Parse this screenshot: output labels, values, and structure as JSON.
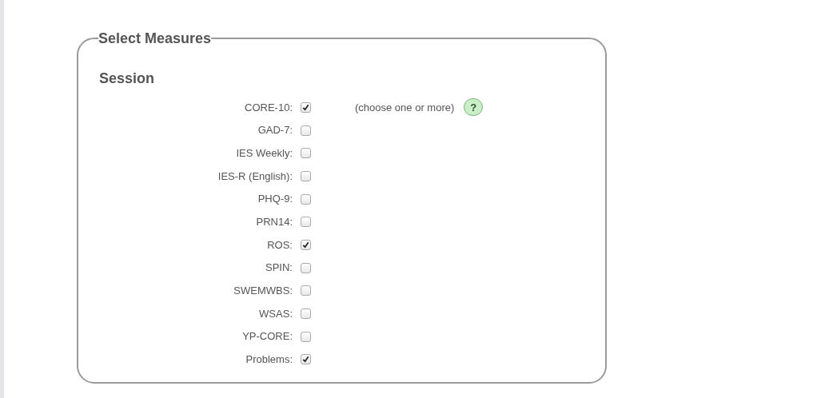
{
  "legend": "Select Measures",
  "section": "Session",
  "hint": "(choose one or more)",
  "help": "?",
  "measures": [
    {
      "label": "CORE-10:",
      "checked": true
    },
    {
      "label": "GAD-7:",
      "checked": false
    },
    {
      "label": "IES Weekly:",
      "checked": false
    },
    {
      "label": "IES-R (English):",
      "checked": false
    },
    {
      "label": "PHQ-9:",
      "checked": false
    },
    {
      "label": "PRN14:",
      "checked": false
    },
    {
      "label": "ROS:",
      "checked": true
    },
    {
      "label": "SPIN:",
      "checked": false
    },
    {
      "label": "SWEMWBS:",
      "checked": false
    },
    {
      "label": "WSAS:",
      "checked": false
    },
    {
      "label": "YP-CORE:",
      "checked": false
    },
    {
      "label": "Problems:",
      "checked": true
    }
  ]
}
